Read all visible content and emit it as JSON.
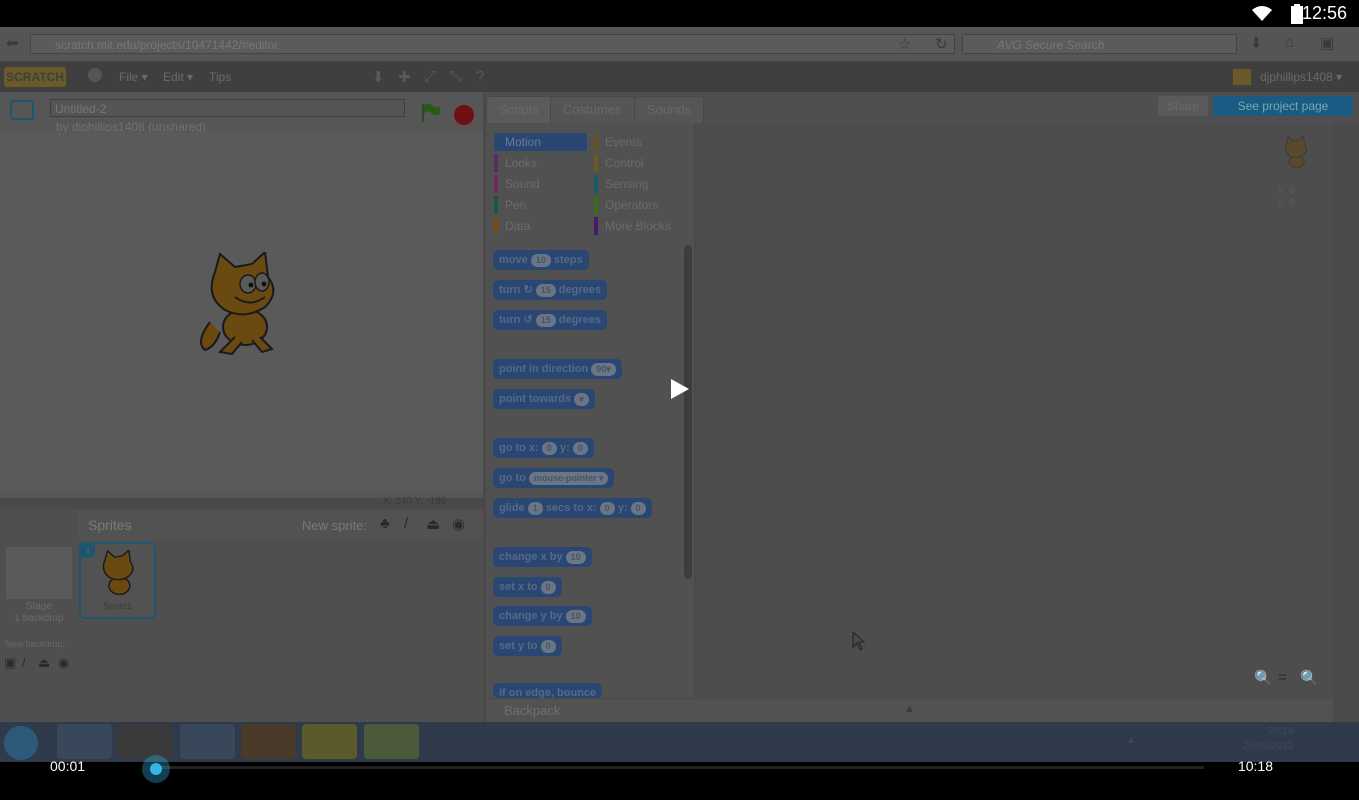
{
  "statusbar": {
    "time": "12:56"
  },
  "browser": {
    "url_host": "scratch.mit.edu",
    "url_path": "/projects/10471442/#editor",
    "search_placeholder": "AVG Secure Search"
  },
  "scratch_menu": {
    "logo": "SCRATCH",
    "file": "File ▾",
    "edit": "Edit ▾",
    "tips": "Tips",
    "username": "djphillips1408 ▾"
  },
  "project": {
    "title": "Untitled-2",
    "byline": "by djphillips1408 (unshared)"
  },
  "stage": {
    "coords": "X: 240   Y: -180"
  },
  "sprites": {
    "label": "Sprites",
    "new_sprite": "New sprite:",
    "stage_label": "Stage",
    "stage_backdrops": "1 backdrop",
    "new_backdrop": "New backdrop:",
    "sprite_name": "Sprite1",
    "sprite_index": "i"
  },
  "tabs": [
    "Scripts",
    "Costumes",
    "Sounds"
  ],
  "buttons": {
    "share": "Share",
    "see_project": "See project page"
  },
  "categories_left": [
    "Motion",
    "Looks",
    "Sound",
    "Pen",
    "Data"
  ],
  "categories_right": [
    "Events",
    "Control",
    "Sensing",
    "Operators",
    "More Blocks"
  ],
  "category_colors": {
    "Motion": "#2a4672",
    "Looks": "#5a2a6a",
    "Sound": "#6a2a5a",
    "Pen": "#1a5a3a",
    "Data": "#7a4a1a",
    "Events": "#6a5020",
    "Control": "#6a5a20",
    "Sensing": "#1a5a6a",
    "Operators": "#3a6a1a",
    "More Blocks": "#4a1a6a"
  },
  "blocks": {
    "move": {
      "a": "move",
      "v": "10",
      "b": "steps"
    },
    "turn_cw": {
      "a": "turn ↻",
      "v": "15",
      "b": "degrees"
    },
    "turn_ccw": {
      "a": "turn ↺",
      "v": "15",
      "b": "degrees"
    },
    "point_dir": {
      "a": "point in direction",
      "v": "90▾"
    },
    "point_towards": {
      "a": "point towards",
      "v": "▾"
    },
    "goto_xy": {
      "a": "go to x:",
      "v": "0",
      "b": "y:",
      "v2": "0"
    },
    "goto": {
      "a": "go to",
      "v": "mouse-pointer ▾"
    },
    "glide": {
      "a": "glide",
      "v": "1",
      "b": "secs to x:",
      "v2": "0",
      "c": "y:",
      "v3": "0"
    },
    "change_x": {
      "a": "change x by",
      "v": "10"
    },
    "set_x": {
      "a": "set x to",
      "v": "0"
    },
    "change_y": {
      "a": "change y by",
      "v": "10"
    },
    "set_y": {
      "a": "set y to",
      "v": "0"
    },
    "bounce": {
      "a": "if on edge, bounce"
    }
  },
  "script_area": {
    "x": "x: 0",
    "y": "y: 0"
  },
  "backpack": "Backpack",
  "taskbar": {
    "time": "20:14",
    "date": "26/05/2013"
  },
  "video": {
    "elapsed": "00:01",
    "duration": "10:18",
    "progress": 0.002
  }
}
